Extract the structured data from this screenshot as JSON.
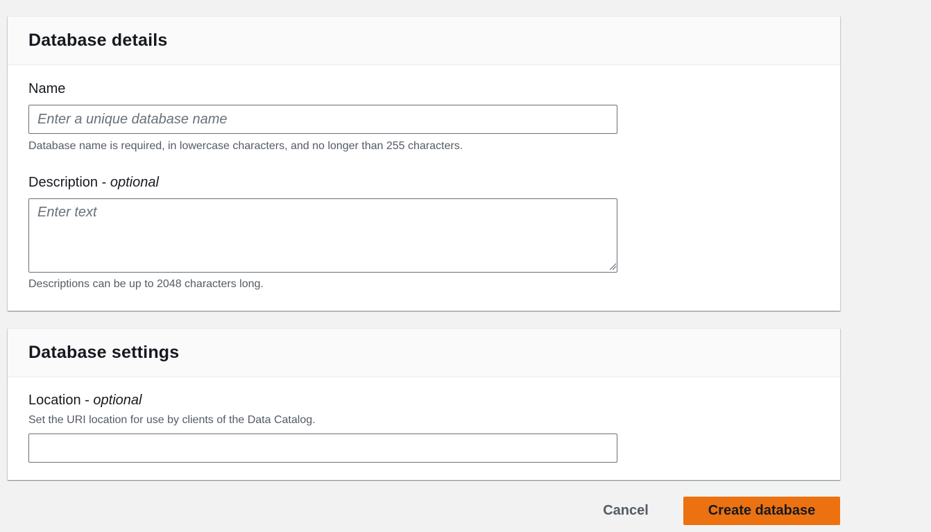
{
  "details": {
    "title": "Database details",
    "name_label": "Name",
    "name_placeholder": "Enter a unique database name",
    "name_value": "",
    "name_hint": "Database name is required, in lowercase characters, and no longer than 255 characters.",
    "description_label": "Description",
    "description_optional": "optional",
    "description_separator": " - ",
    "description_placeholder": "Enter text",
    "description_value": "",
    "description_hint": "Descriptions can be up to 2048 characters long."
  },
  "settings": {
    "title": "Database settings",
    "location_label": "Location",
    "location_separator": " - ",
    "location_optional": "optional",
    "location_hint": "Set the URI location for use by clients of the Data Catalog.",
    "location_value": ""
  },
  "actions": {
    "cancel_label": "Cancel",
    "create_label": "Create database"
  },
  "colors": {
    "primary_button": "#ec7211",
    "page_background": "#f2f2f2",
    "hint_text": "#545b64",
    "input_border": "#687078"
  },
  "icons": {
    "resize_grip": "resize-grip-icon"
  }
}
